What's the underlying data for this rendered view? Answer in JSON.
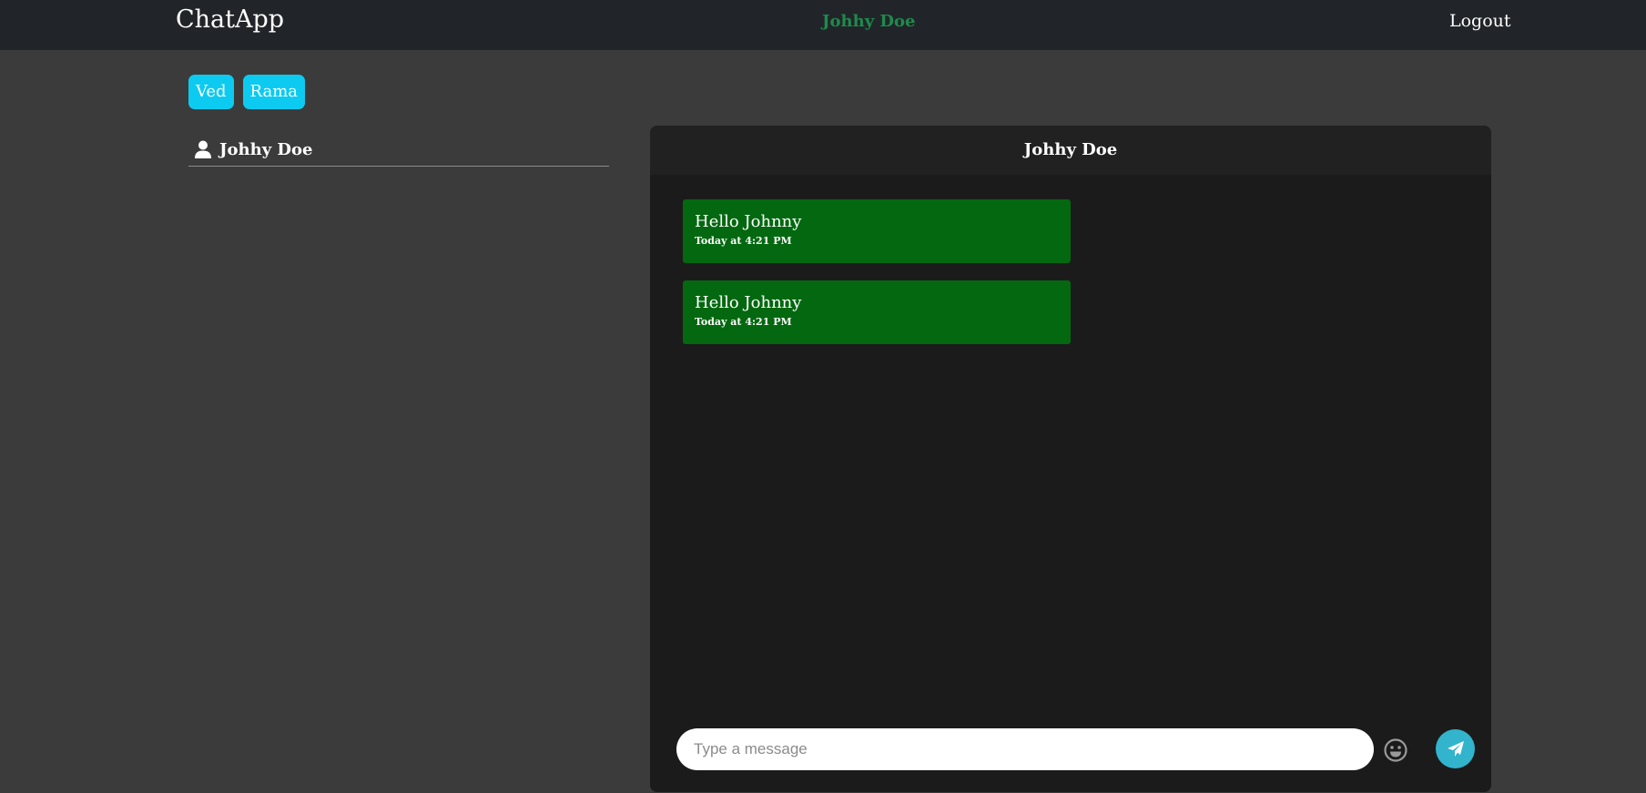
{
  "navbar": {
    "brand": "ChatApp",
    "current_user": "Johhy Doe",
    "logout_label": "Logout"
  },
  "groups": [
    {
      "label": "Ved"
    },
    {
      "label": "Rama"
    }
  ],
  "users": [
    {
      "name": "Johhy Doe",
      "icon": "user-icon"
    }
  ],
  "chat": {
    "header_title": "Johhy Doe",
    "messages": [
      {
        "text": "Hello Johnny",
        "time": "Today at 4:21 PM"
      },
      {
        "text": "Hello Johnny",
        "time": "Today at 4:21 PM"
      }
    ],
    "input_placeholder": "Type a message",
    "input_value": "",
    "emoji_icon": "smiley-icon",
    "send_icon": "paper-plane-icon"
  },
  "colors": {
    "page_background": "#3b3b3b",
    "navbar_background": "#212529",
    "current_user_color": "#1f8a4c",
    "group_button": "#0dcaf0",
    "message_bubble": "#03680f",
    "send_button": "#32b4cd"
  }
}
